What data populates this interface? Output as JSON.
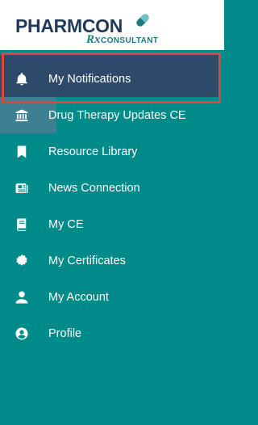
{
  "brand": {
    "word": "PHARMCON",
    "rx": "Rx",
    "tagline": "CONSULTANT",
    "colors": {
      "navy": "#1f3a5a",
      "teal": "#1f7a7a"
    }
  },
  "sidebar": {
    "background": "#008b8b",
    "active_background": "#2e4a6b",
    "highlight_color": "#e0453c",
    "items": [
      {
        "label": "My Notifications",
        "icon": "bell-icon",
        "active": true
      },
      {
        "label": "Drug Therapy Updates CE",
        "icon": "institution-icon"
      },
      {
        "label": "Resource Library",
        "icon": "bookmark-icon"
      },
      {
        "label": "News Connection",
        "icon": "newspaper-icon"
      },
      {
        "label": "My CE",
        "icon": "book-icon"
      },
      {
        "label": "My Certificates",
        "icon": "certificate-icon"
      },
      {
        "label": "My Account",
        "icon": "user-icon"
      },
      {
        "label": "Profile",
        "icon": "user-circle-icon"
      }
    ]
  }
}
